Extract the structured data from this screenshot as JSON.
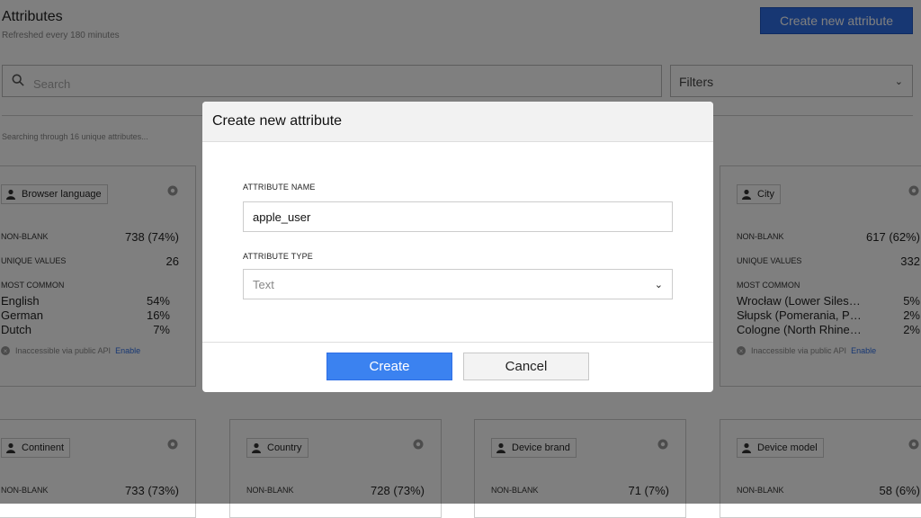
{
  "header": {
    "title": "Attributes",
    "subtitle": "Refreshed every 180 minutes",
    "create_button": "Create new attribute"
  },
  "search": {
    "placeholder": "Search"
  },
  "filters": {
    "label": "Filters"
  },
  "status_text": "Searching through 16 unique attributes...",
  "labels": {
    "non_blank": "NON-BLANK",
    "unique_values": "UNIQUE VALUES",
    "most_common": "MOST COMMON",
    "api_text": "Inaccessible via public API",
    "enable": "Enable"
  },
  "cards": [
    {
      "name": "Browser language",
      "non_blank": "738 (74%)",
      "unique_values": "26",
      "most_common": [
        {
          "name": "English",
          "pct": "54%"
        },
        {
          "name": "German",
          "pct": "16%"
        },
        {
          "name": "Dutch",
          "pct": "7%"
        }
      ]
    },
    {
      "name": "City",
      "non_blank": "617 (62%)",
      "unique_values": "332",
      "most_common": [
        {
          "name": "Wrocław (Lower Siles…",
          "pct": "5%"
        },
        {
          "name": "Słupsk (Pomerania, P…",
          "pct": "2%"
        },
        {
          "name": "Cologne (North Rhine…",
          "pct": "2%"
        }
      ]
    },
    {
      "name": "Continent",
      "non_blank": "733 (73%)"
    },
    {
      "name": "Country",
      "non_blank": "728 (73%)"
    },
    {
      "name": "Device brand",
      "non_blank": "71 (7%)"
    },
    {
      "name": "Device model",
      "non_blank": "58 (6%)"
    }
  ],
  "modal": {
    "title": "Create new attribute",
    "name_label": "ATTRIBUTE NAME",
    "name_value": "apple_user",
    "type_label": "ATTRIBUTE TYPE",
    "type_value": "Text",
    "create": "Create",
    "cancel": "Cancel"
  }
}
